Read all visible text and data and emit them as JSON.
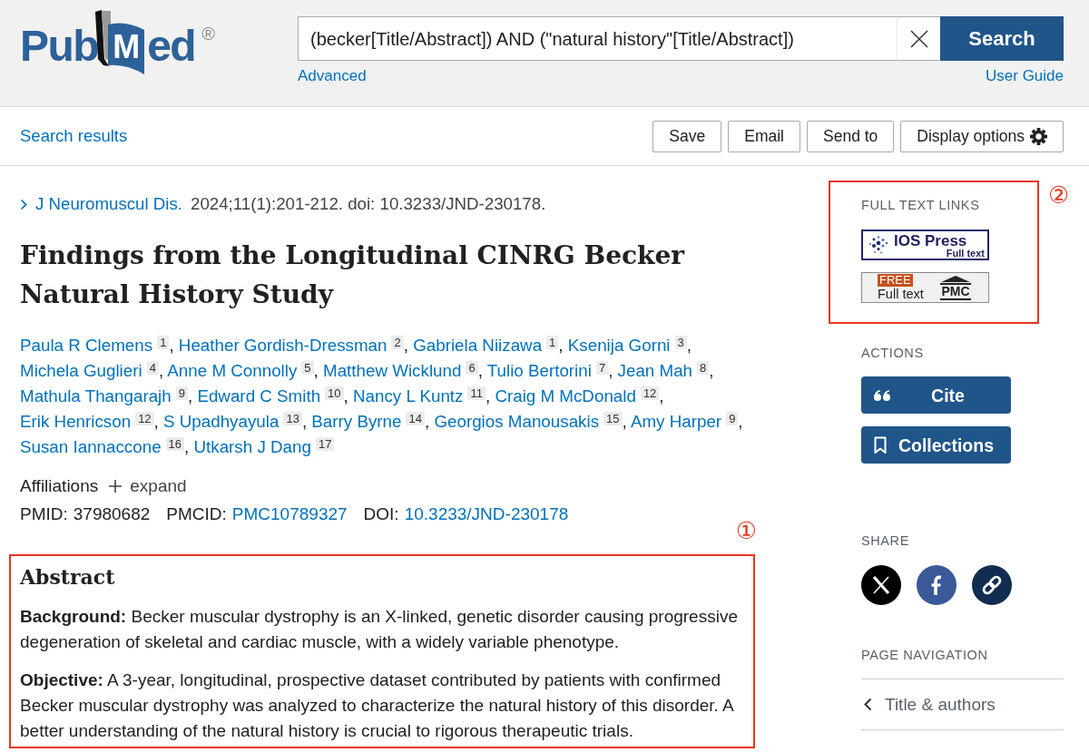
{
  "header": {
    "logo": {
      "left": "Pub",
      "right": "Med",
      "mark": "®"
    },
    "search": {
      "value": "(becker[Title/Abstract]) AND (\"natural history\"[Title/Abstract])",
      "button": "Search"
    },
    "links": [
      {
        "label": "Advanced"
      },
      {
        "label": "User Guide"
      }
    ]
  },
  "toolbar": {
    "back_link": "Search results",
    "buttons": [
      {
        "label": "Save",
        "kind": "plain"
      },
      {
        "label": "Email",
        "kind": "plain"
      },
      {
        "label": "Send to",
        "kind": "plain"
      },
      {
        "label": "Display options",
        "kind": "settings"
      }
    ]
  },
  "article": {
    "journal": "J Neuromuscul Dis.",
    "citation": "2024;11(1):201-212. doi: 10.3233/JND-230178.",
    "title": "Findings from the Longitudinal CINRG Becker Natural History Study",
    "author_separator": ",",
    "authors": [
      {
        "name": "Paula R Clemens",
        "affiliation": "1"
      },
      {
        "name": "Heather Gordish-Dressman",
        "affiliation": "2"
      },
      {
        "name": "Gabriela Niizawa",
        "affiliation": "1"
      },
      {
        "name": "Ksenija Gorni",
        "affiliation": "3"
      },
      {
        "name": "Michela Guglieri",
        "affiliation": "4"
      },
      {
        "name": "Anne M Connolly",
        "affiliation": "5"
      },
      {
        "name": "Matthew Wicklund",
        "affiliation": "6"
      },
      {
        "name": "Tulio Bertorini",
        "affiliation": "7"
      },
      {
        "name": "Jean Mah",
        "affiliation": "8"
      },
      {
        "name": "Mathula Thangarajh",
        "affiliation": "9"
      },
      {
        "name": "Edward C Smith",
        "affiliation": "10"
      },
      {
        "name": "Nancy L Kuntz",
        "affiliation": "11"
      },
      {
        "name": "Craig M McDonald",
        "affiliation": "12"
      },
      {
        "name": "Erik Henricson",
        "affiliation": "12"
      },
      {
        "name": "S Upadhyayula",
        "affiliation": "13"
      },
      {
        "name": "Barry Byrne",
        "affiliation": "14"
      },
      {
        "name": "Georgios Manousakis",
        "affiliation": "15"
      },
      {
        "name": "Amy Harper",
        "affiliation": "9"
      },
      {
        "name": "Susan Iannaccone",
        "affiliation": "16"
      },
      {
        "name": "Utkarsh J Dang",
        "affiliation": "17"
      }
    ],
    "affiliations": {
      "label": "Affiliations",
      "toggle": "expand",
      "expanded": false
    },
    "identifiers": [
      {
        "label": "PMID:",
        "value": "37980682",
        "link": false
      },
      {
        "label": "PMCID:",
        "value": "PMC10789327",
        "link": true
      },
      {
        "label": "DOI:",
        "value": "10.3233/JND-230178",
        "link": true
      }
    ]
  },
  "abstract": {
    "heading": "Abstract",
    "callout": "①",
    "paragraphs": [
      "**Background:** Becker muscular dystrophy is an X-linked, genetic disorder causing progressive degeneration of skeletal and cardiac muscle, with a widely variable phenotype.",
      "**Objective:** A 3-year, longitudinal, prospective dataset contributed by patients with confirmed Becker muscular dystrophy was analyzed to characterize the natural history of this disorder. A better understanding of the natural history is crucial to rigorous therapeutic trials."
    ]
  },
  "sidebar": {
    "full_text_links": {
      "heading": "FULL TEXT LINKS",
      "callout": "②",
      "links": [
        {
          "kind": "publisher",
          "name": "IOS Press",
          "caption": "Full text"
        },
        {
          "kind": "pmc",
          "badge": "FREE",
          "caption": "Full text",
          "name": "PMC"
        }
      ]
    },
    "actions": {
      "heading": "ACTIONS",
      "buttons": [
        {
          "label": "Cite",
          "kind": "cite"
        },
        {
          "label": "Collections",
          "kind": "collections"
        }
      ]
    },
    "share": {
      "heading": "SHARE",
      "buttons": [
        {
          "kind": "x"
        },
        {
          "kind": "facebook"
        },
        {
          "kind": "link"
        }
      ]
    },
    "page_navigation": {
      "heading": "PAGE NAVIGATION",
      "items": [
        {
          "label": "Title & authors"
        }
      ]
    }
  }
}
